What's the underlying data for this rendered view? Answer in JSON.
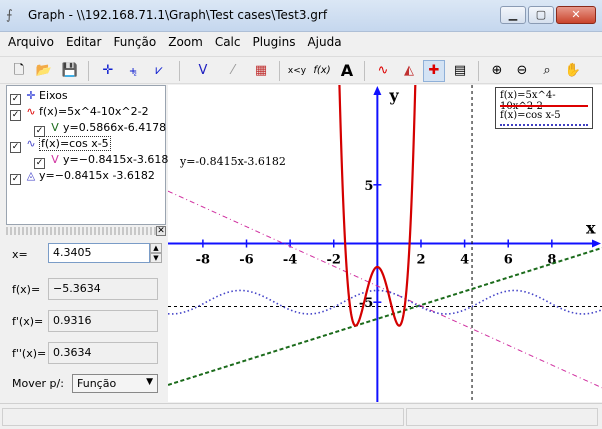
{
  "window": {
    "title": "Graph - \\\\192.168.71.1\\Graph\\Test cases\\Test3.grf"
  },
  "menu": [
    "Arquivo",
    "Editar",
    "Função",
    "Zoom",
    "Calc",
    "Plugins",
    "Ajuda"
  ],
  "toolbar": [
    {
      "icon": "new-file-icon",
      "glyph": "🗋"
    },
    {
      "icon": "open-folder-icon",
      "glyph": "📂"
    },
    {
      "icon": "save-icon",
      "glyph": "💾"
    },
    {
      "icon": "axes-icon",
      "glyph": "✛"
    },
    {
      "icon": "insert-function-icon",
      "glyph": "⨧"
    },
    {
      "icon": "insert-series-icon",
      "glyph": "⩗"
    },
    {
      "icon": "tangent-icon",
      "glyph": "V"
    },
    {
      "icon": "shading-icon",
      "glyph": "⁄"
    },
    {
      "icon": "area-icon",
      "glyph": "▦"
    },
    {
      "icon": "relation-icon",
      "glyph": "x<y"
    },
    {
      "icon": "fx-icon",
      "glyph": "f(x)"
    },
    {
      "icon": "text-icon",
      "glyph": "A"
    },
    {
      "icon": "trendline-icon",
      "glyph": "∿"
    },
    {
      "icon": "area-fill-icon",
      "glyph": "◭"
    },
    {
      "icon": "eval-icon",
      "glyph": "✚"
    },
    {
      "icon": "table-icon",
      "glyph": "▤"
    },
    {
      "icon": "zoom-in-icon",
      "glyph": "⊕"
    },
    {
      "icon": "zoom-out-icon",
      "glyph": "⊖"
    },
    {
      "icon": "zoom-fit-icon",
      "glyph": "⌕"
    },
    {
      "icon": "pan-hand-icon",
      "glyph": "✋"
    }
  ],
  "tree": {
    "axes": "Eixos",
    "f1": "f(x)=5x^4-10x^2-2",
    "f1_tangent": "y=0.5866x-6.4178",
    "f2": "f(x)=cos x-5",
    "f2_tangent": "y=−0.8415x-3.6182",
    "line": "y=−0.8415x -3.6182"
  },
  "eval": {
    "x_label": "x=",
    "x_value": "4.3405",
    "fx_label": "f(x)=",
    "fx_value": "−5.3634",
    "fpx_label": "f'(x)=",
    "fpx_value": "0.9316",
    "fppx_label": "f''(x)=",
    "fppx_value": "0.3634",
    "move_label": "Mover p/:",
    "move_value": "Função"
  },
  "graph": {
    "x_axis_label": "x",
    "y_axis_label": "y",
    "x_ticks": [
      "-8",
      "-6",
      "-4",
      "-2",
      "2",
      "4",
      "6",
      "8"
    ],
    "y_ticks": [
      "5",
      "-5"
    ],
    "line_label": "y=-0.8415x-3.6182",
    "legend_f1": "f(x)=5x^4-10x^2-2",
    "legend_f2": "f(x)=cos x-5",
    "colors": {
      "f1": "#d40000",
      "f2": "#4444c8",
      "tangent1": "#1b6b1b",
      "tangent2": "#d030a0",
      "axis": "#1010ff"
    }
  },
  "chart_data": {
    "type": "line",
    "xlim": [
      -9.6,
      10.3
    ],
    "ylim": [
      -13.5,
      13.5
    ],
    "grid": false,
    "series": [
      {
        "name": "f(x)=5x^4-10x^2-2",
        "expr": "5x^4-10x^2-2"
      },
      {
        "name": "f(x)=cos x-5",
        "expr": "cos x-5"
      },
      {
        "name": "y=0.5866x-6.4178",
        "expr": "0.5866x-6.4178"
      },
      {
        "name": "y=-0.8415x-3.6182",
        "expr": "-0.8415x-3.6182"
      }
    ]
  }
}
